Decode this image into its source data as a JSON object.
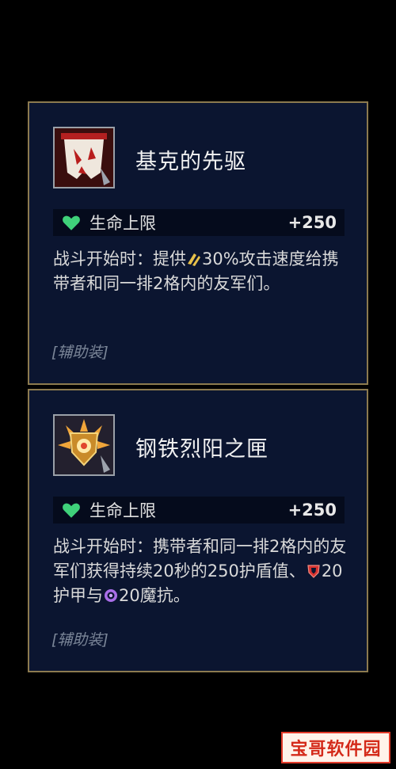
{
  "items": [
    {
      "name": "基克的先驱",
      "icon": "banner-icon",
      "stat": {
        "icon": "heart-icon",
        "label": "生命上限",
        "value": "+250"
      },
      "desc_before": "战斗开始时：提供",
      "desc_icon": "attack-speed-icon",
      "desc_after": "30%攻击速度给携带者和同一排2格内的友军们。",
      "tag": "[辅助装]"
    },
    {
      "name": "钢铁烈阳之匣",
      "icon": "sun-shield-icon",
      "stat": {
        "icon": "heart-icon",
        "label": "生命上限",
        "value": "+250"
      },
      "desc_before": "战斗开始时：携带者和同一排2格内的友军们获得持续20秒的250护盾值、",
      "desc_icon_1": "armor-icon",
      "desc_mid": "20护甲与",
      "desc_icon_2": "magic-resist-icon",
      "desc_after": "20魔抗。",
      "tag": "[辅助装]"
    }
  ],
  "watermark": "宝哥软件园",
  "colors": {
    "panel": "#0b1530",
    "border": "#8c7a4f",
    "heart": "#3fd17a",
    "tag": "#7b8698",
    "watermark": "#d42a1a"
  }
}
